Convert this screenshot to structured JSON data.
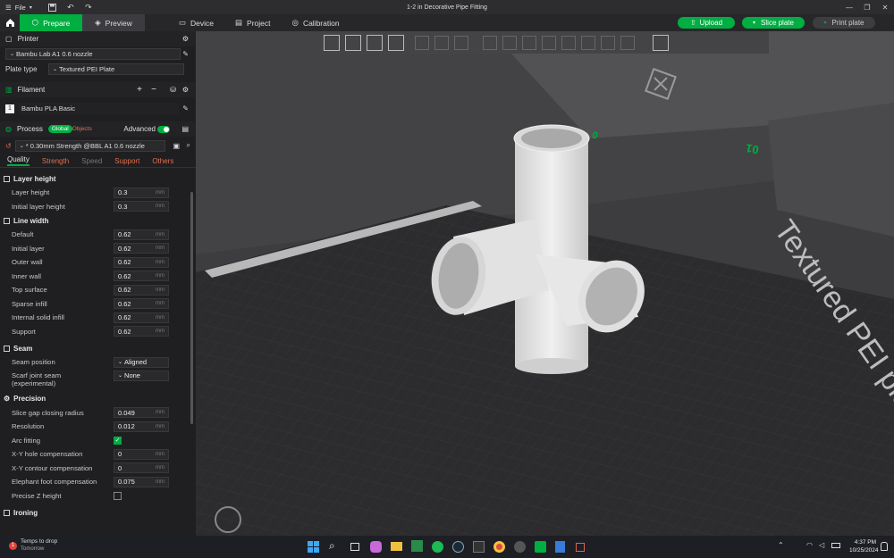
{
  "titlebar": {
    "file_label": "File",
    "title": "1-2 in Decorative Pipe Fitting"
  },
  "nav": {
    "prepare": "Prepare",
    "preview": "Preview",
    "device": "Device",
    "project": "Project",
    "calibration": "Calibration",
    "upload": "Upload",
    "slice_plate": "Slice plate",
    "print_plate": "Print plate"
  },
  "printer": {
    "header": "Printer",
    "model": "Bambu Lab A1 0.6 nozzle",
    "plate_type_label": "Plate type",
    "plate_type_value": "Textured PEI Plate"
  },
  "filament": {
    "header": "Filament",
    "slot": "1",
    "name": "Bambu PLA Basic"
  },
  "process": {
    "header": "Process",
    "global_tag": "Global",
    "objects_tag": "Objects",
    "advanced_label": "Advanced",
    "preset": "* 0.30mm Strength @BBL A1 0.6 nozzle",
    "tabs": [
      "Quality",
      "Strength",
      "Speed",
      "Support",
      "Others"
    ]
  },
  "groups": {
    "layer_height": {
      "title": "Layer height",
      "rows": [
        {
          "label": "Layer height",
          "value": "0.3",
          "unit": "mm"
        },
        {
          "label": "Initial layer height",
          "value": "0.3",
          "unit": "mm"
        }
      ]
    },
    "line_width": {
      "title": "Line width",
      "rows": [
        {
          "label": "Default",
          "value": "0.62",
          "unit": "mm"
        },
        {
          "label": "Initial layer",
          "value": "0.62",
          "unit": "mm"
        },
        {
          "label": "Outer wall",
          "value": "0.62",
          "unit": "mm"
        },
        {
          "label": "Inner wall",
          "value": "0.62",
          "unit": "mm"
        },
        {
          "label": "Top surface",
          "value": "0.62",
          "unit": "mm"
        },
        {
          "label": "Sparse infill",
          "value": "0.62",
          "unit": "mm"
        },
        {
          "label": "Internal solid infill",
          "value": "0.62",
          "unit": "mm"
        },
        {
          "label": "Support",
          "value": "0.62",
          "unit": "mm"
        }
      ]
    },
    "seam": {
      "title": "Seam",
      "seam_position_label": "Seam position",
      "seam_position_value": "Aligned",
      "scarf_label_1": "Scarf joint seam",
      "scarf_label_2": "(experimental)",
      "scarf_value": "None"
    },
    "precision": {
      "title": "Precision",
      "rows": [
        {
          "label": "Slice gap closing radius",
          "value": "0.049",
          "unit": "mm"
        },
        {
          "label": "Resolution",
          "value": "0.012",
          "unit": "mm"
        }
      ],
      "arc_fitting_label": "Arc fitting",
      "arc_fitting_checked": true,
      "rows2": [
        {
          "label": "X-Y hole compensation",
          "value": "0",
          "unit": "mm"
        },
        {
          "label": "X-Y contour compensation",
          "value": "0",
          "unit": "mm"
        },
        {
          "label": "Elephant foot compensation",
          "value": "0.075",
          "unit": "mm"
        }
      ],
      "precise_z_label": "Precise Z height",
      "precise_z_checked": false
    },
    "ironing": {
      "title": "Ironing"
    }
  },
  "viewport": {
    "plate_text": "Textured PEI plate",
    "plate_label_far": "01",
    "plate_label_near": "0"
  },
  "taskbar": {
    "weather_badge": "1",
    "weather_title": "Temps to drop",
    "weather_sub": "Tomorrow",
    "time": "4:37 PM",
    "date": "10/25/2024"
  },
  "colors": {
    "accent": "#00ae42",
    "sidebar_bg": "#1f1f21",
    "bed": "#2a2a2c",
    "model": "#e6e6e6"
  }
}
